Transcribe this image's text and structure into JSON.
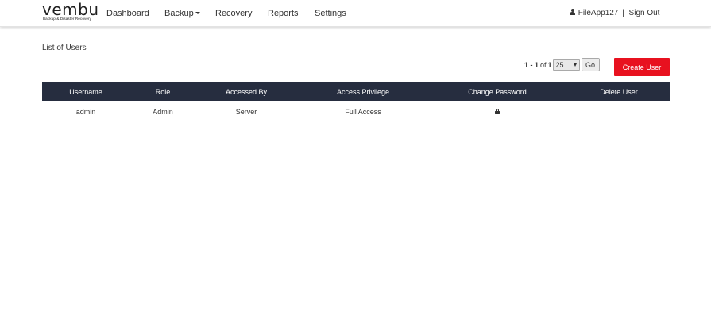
{
  "brand": {
    "name": "vembu",
    "tagline": "Backup & Disaster Recovery"
  },
  "nav": {
    "items": [
      {
        "label": "Dashboard"
      },
      {
        "label": "Backup"
      },
      {
        "label": "Recovery"
      },
      {
        "label": "Reports"
      },
      {
        "label": "Settings"
      }
    ],
    "user": "FileApp127",
    "separator": "|",
    "sign_out": "Sign Out"
  },
  "page": {
    "title": "List of Users"
  },
  "pagination": {
    "range": "1 - 1",
    "of_label": "of",
    "total": "1",
    "page_size": "25",
    "go_label": "Go"
  },
  "actions": {
    "create_user": "Create User"
  },
  "colors": {
    "accent": "#e8111f",
    "table_header": "#262d3f"
  },
  "table": {
    "headers": [
      "Username",
      "Role",
      "Accessed By",
      "Access Privilege",
      "Change Password",
      "Delete User"
    ],
    "rows": [
      {
        "username": "admin",
        "role": "Admin",
        "accessed_by": "Server",
        "access_privilege": "Full Access",
        "change_password_icon": "lock-icon"
      }
    ]
  }
}
